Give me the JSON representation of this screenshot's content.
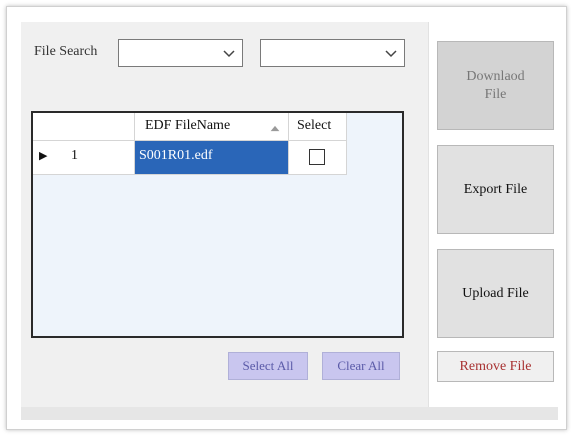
{
  "search": {
    "label": "File Search",
    "combo1_value": "",
    "combo2_value": ""
  },
  "grid": {
    "columns": [
      "",
      "EDF FileName",
      "Select"
    ],
    "sort_indicator": "ascending",
    "rows": [
      {
        "row_marker": "▶",
        "index": "1",
        "filename": "S001R01.edf",
        "selected": false
      }
    ]
  },
  "buttons": {
    "select_all": "Select All",
    "clear_all": "Clear All",
    "download_line1": "Downlaod",
    "download_line2": "File",
    "export": "Export File",
    "upload": "Upload File",
    "remove": "Remove File"
  },
  "colors": {
    "selection": "#2a66b8",
    "remove_text": "#a83232",
    "small_button_bg": "#c9c6ef",
    "small_button_text": "#5a5aa8"
  }
}
